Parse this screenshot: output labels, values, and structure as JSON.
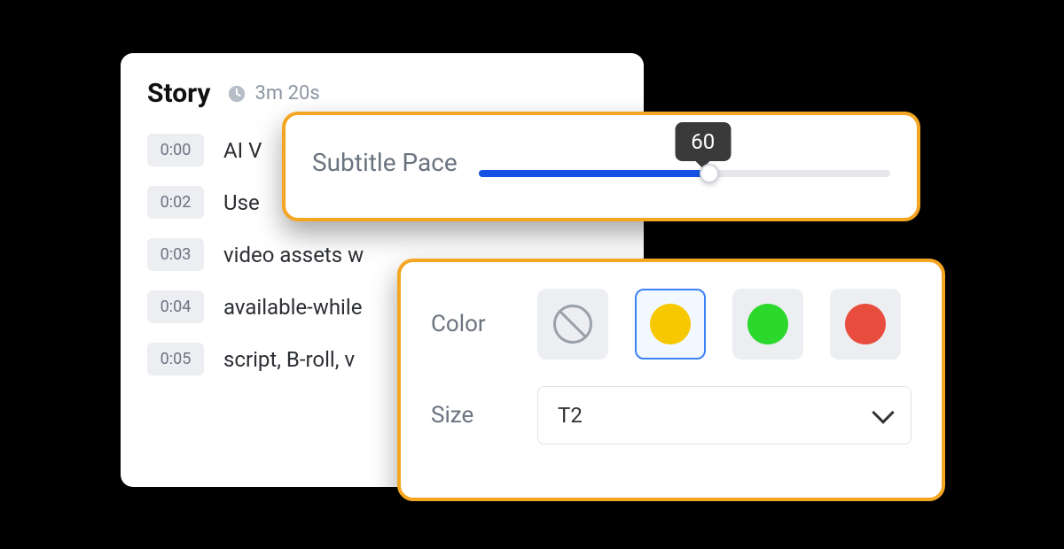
{
  "story": {
    "title": "Story",
    "duration": "3m 20s",
    "rows": [
      {
        "time": "0:00",
        "text": "AI V"
      },
      {
        "time": "0:02",
        "text": "Use"
      },
      {
        "time": "0:03",
        "text": "video assets w"
      },
      {
        "time": "0:04",
        "text": "available-while"
      },
      {
        "time": "0:05",
        "text": "script, B-roll, v"
      }
    ]
  },
  "pace": {
    "label": "Subtitle Pace",
    "value": "60",
    "percent": 56
  },
  "style": {
    "color_label": "Color",
    "size_label": "Size",
    "swatches": [
      {
        "name": "none",
        "selected": false
      },
      {
        "name": "yellow",
        "selected": true
      },
      {
        "name": "green",
        "selected": false
      },
      {
        "name": "red",
        "selected": false
      }
    ],
    "size_value": "T2"
  }
}
